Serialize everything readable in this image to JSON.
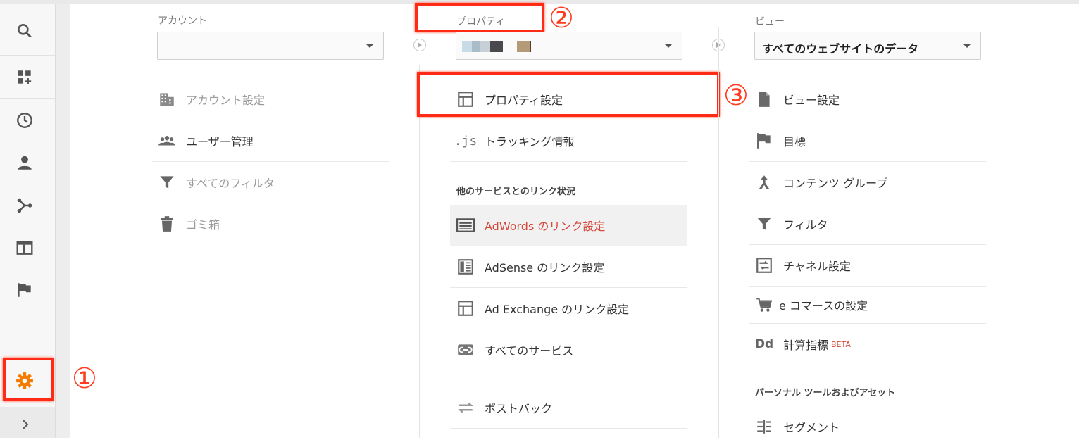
{
  "account_column": {
    "header": "アカウント",
    "items": [
      {
        "label": "アカウント設定",
        "icon": "building-icon",
        "disabled": true
      },
      {
        "label": "ユーザー管理",
        "icon": "users-icon",
        "disabled": false
      },
      {
        "label": "すべてのフィルタ",
        "icon": "filter-icon",
        "disabled": true
      },
      {
        "label": "ゴミ箱",
        "icon": "trash-icon",
        "disabled": true
      }
    ]
  },
  "property_column": {
    "header": "プロパティ",
    "items": [
      {
        "label": "プロパティ設定",
        "icon": "layout-icon"
      },
      {
        "label": "トラッキング情報",
        "icon": "js-icon"
      }
    ],
    "link_section_header": "他のサービスとのリンク状況",
    "link_items": [
      {
        "label": "AdWords のリンク設定",
        "icon": "adwords-icon",
        "active": true
      },
      {
        "label": "AdSense のリンク設定",
        "icon": "adsense-icon"
      },
      {
        "label": "Ad Exchange のリンク設定",
        "icon": "adexchange-icon"
      },
      {
        "label": "すべてのサービス",
        "icon": "link-icon"
      }
    ],
    "postback": {
      "label": "ポストバック",
      "icon": "postback-icon"
    }
  },
  "view_column": {
    "header": "ビュー",
    "selected": "すべてのウェブサイトのデータ",
    "items": [
      {
        "label": "ビュー設定",
        "icon": "document-icon"
      },
      {
        "label": "目標",
        "icon": "flag-icon"
      },
      {
        "label": "コンテンツ グループ",
        "icon": "content-group-icon"
      },
      {
        "label": "フィルタ",
        "icon": "filter-icon"
      },
      {
        "label": "チャネル設定",
        "icon": "channel-icon"
      },
      {
        "label": "e コマースの設定",
        "icon": "cart-icon"
      },
      {
        "label": "計算指標",
        "icon": "dd-icon",
        "badge": "BETA"
      }
    ],
    "personal_section_header": "パーソナル ツールおよびアセット",
    "personal_items": [
      {
        "label": "セグメント",
        "icon": "segment-icon"
      }
    ]
  },
  "annotations": {
    "one": "①",
    "two": "②",
    "three": "③"
  },
  "icon_text": {
    "js": ".js",
    "dd": "Dd"
  },
  "colors": {
    "accent_red": "#ff2b17",
    "settings_orange": "#f57c00",
    "link_active": "#d6473b"
  }
}
